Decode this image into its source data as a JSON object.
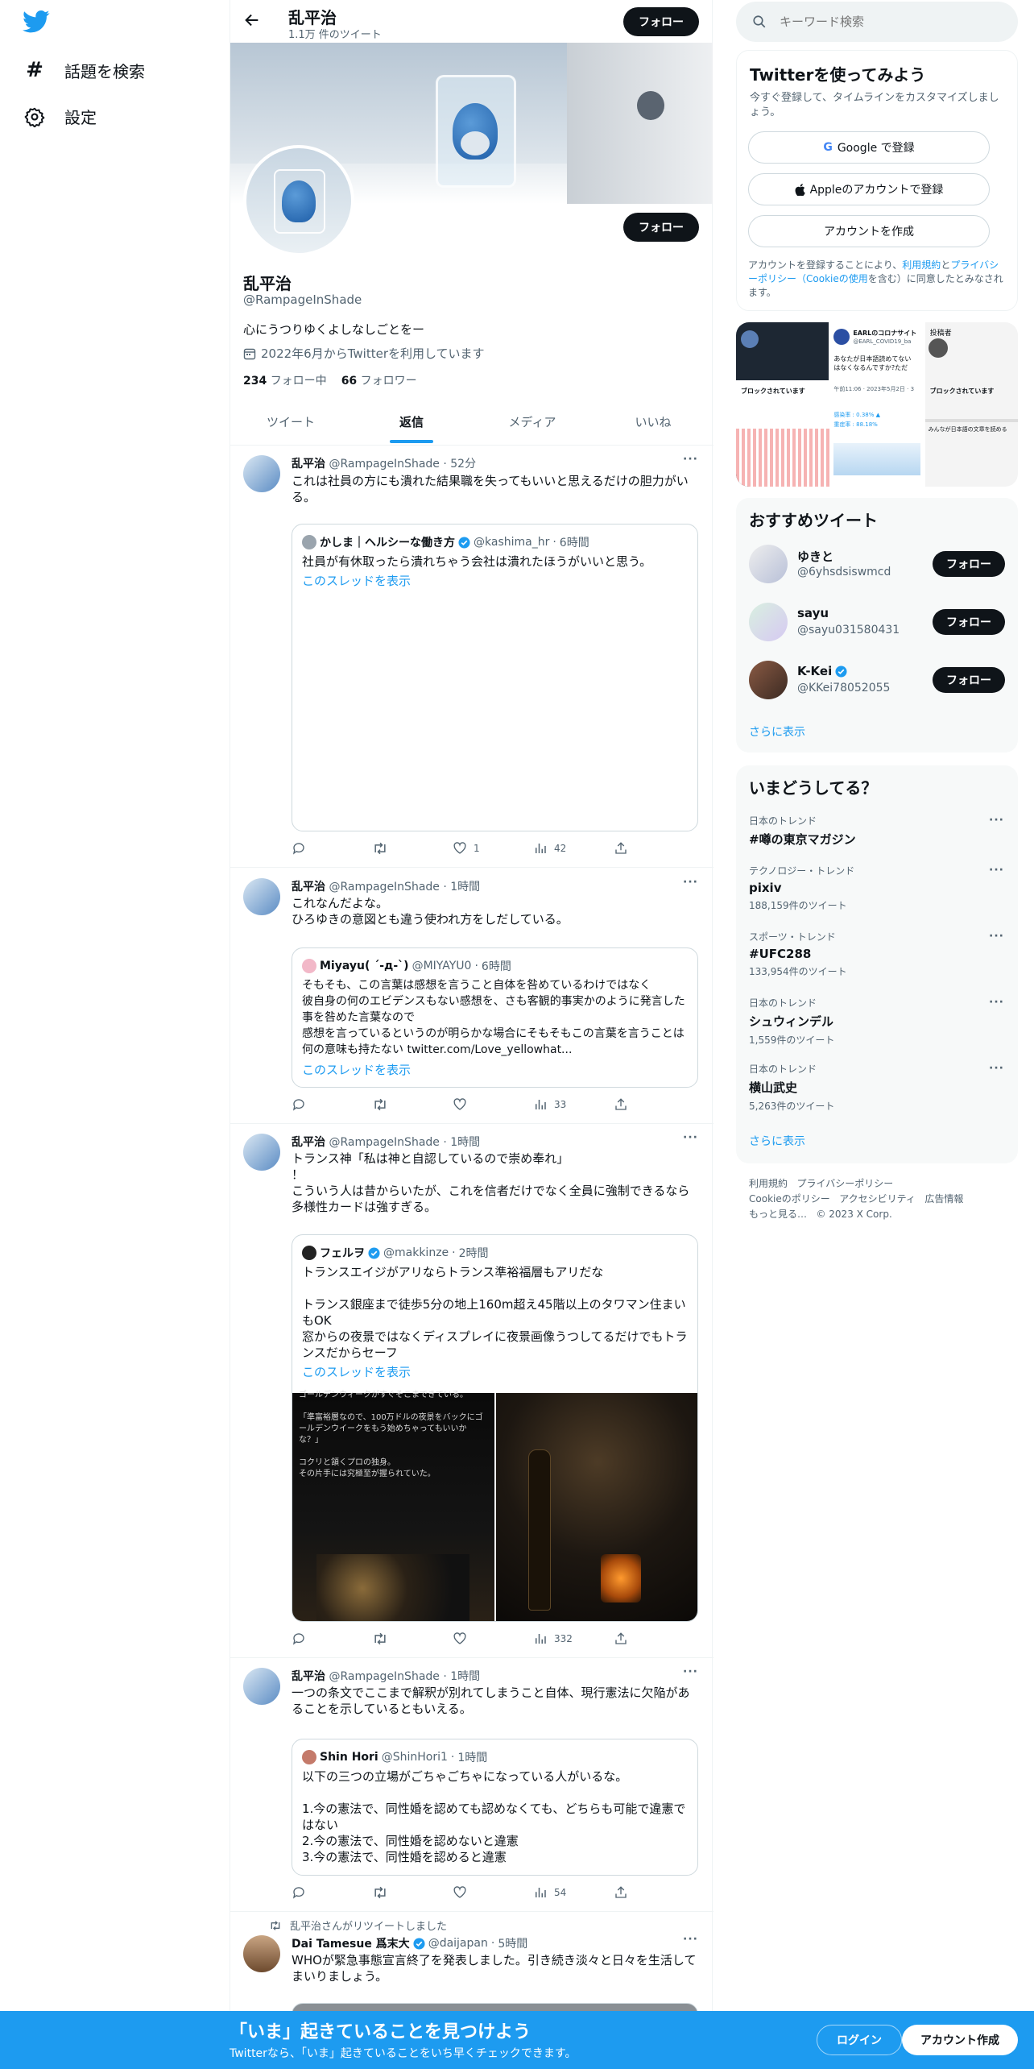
{
  "nav": {
    "explore": "話題を検索",
    "settings": "設定"
  },
  "header": {
    "name": "乱平治",
    "tweet_count": "1.1万 件のツイート",
    "follow": "フォロー"
  },
  "profile": {
    "name": "乱平治",
    "handle": "@RampageInShade",
    "bio": "心にうつりゆくよしなしごとをー",
    "joined": "2022年6月からTwitterを利用しています",
    "following_count": "234",
    "following_label": "フォロー中",
    "followers_count": "66",
    "followers_label": "フォロワー",
    "follow": "フォロー"
  },
  "tabs": [
    "ツイート",
    "返信",
    "メディア",
    "いいね"
  ],
  "tweets": [
    {
      "name": "乱平治",
      "handle": "@RampageInShade",
      "time": "52分",
      "text": "これは社員の方にも潰れた結果職を失ってもいいと思えるだけの胆力がいる。",
      "quote": {
        "name": "かしま｜ヘルシーな働き方",
        "handle": "@kashima_hr",
        "time": "6時間",
        "text": "社員が有休取ったら潰れちゃう会社は潰れたほうがいいと思う。",
        "thread": "このスレッドを表示"
      },
      "likes": "1",
      "views": "42"
    },
    {
      "name": "乱平治",
      "handle": "@RampageInShade",
      "time": "1時間",
      "text": "これなんだよな。\nひろゆきの意図とも違う使われ方をしだしている。",
      "quote": {
        "name": "Miyayu( ´-д-`)",
        "handle": "@MIYAYU0",
        "time": "6時間",
        "text": "そもそも、この言葉は感想を言うこと自体を咎めているわけではなく\n彼自身の何のエビデンスもない感想を、さも客観的事実かのように発言した事を咎めた言葉なので\n感想を言っているというのが明らかな場合にそもそもこの言葉を言うことは何の意味も持たない twitter.com/Love_yellowhat...",
        "thread": "このスレッドを表示"
      },
      "views": "33"
    },
    {
      "name": "乱平治",
      "handle": "@RampageInShade",
      "time": "1時間",
      "text": "トランス神「私は神と自認しているので崇め奉れ」\n！\nこういう人は昔からいたが、これを信者だけでなく全員に強制できるなら多様性カードは強すぎる。",
      "quote": {
        "name": "フェルヲ",
        "handle": "@makkinze",
        "time": "2時間",
        "text": "トランスエイジがアリならトランス準裕福層もアリだな\n\nトランス銀座まで徒歩5分の地上160m超え45階以上のタワマン住まいもOK\n窓からの夜景ではなくディスプレイに夜景画像うつしてるだけでもトランスだからセーフ",
        "thread": "このスレッドを表示",
        "img_text": "ゴールデンウィークがすぐそこまできている。\n\n「準富裕層なので、100万ドルの夜景をバックにゴールデンウイークをもう始めちゃってもいいかな？」\n\nコクリと頷くプロの独身。\nその片手には究極至が握られていた。"
      },
      "views": "332"
    },
    {
      "name": "乱平治",
      "handle": "@RampageInShade",
      "time": "1時間",
      "text": "一つの条文でここまで解釈が別れてしまうこと自体、現行憲法に欠陥があることを示しているともいえる。",
      "quote": {
        "name": "Shin Hori",
        "handle": "@ShinHori1",
        "time": "1時間",
        "text": "以下の三つの立場がごちゃごちゃになっている人がいるな。\n\n1.今の憲法で、同性婚を認めても認めなくても、どちらも可能で違憲ではない\n2.今の憲法で、同性婚を認めないと違憲\n3.今の憲法で、同性婚を認めると違憲"
      },
      "views": "54"
    },
    {
      "retweet_label": "乱平治さんがリツイートしました",
      "name": "Dai Tamesue 爲末大",
      "handle": "@daijapan",
      "time": "5時間",
      "text": "WHOが緊急事態宣言終了を発表しました。引き続き淡々と日々を生活してまいりましょう。"
    }
  ],
  "sidebar": {
    "search_placeholder": "キーワード検索",
    "signup": {
      "title": "Twitterを使ってみよう",
      "desc": "今すぐ登録して、タイムラインをカスタマイズしましょう。",
      "google": "Google で登録",
      "apple": "Appleのアカウントで登録",
      "create": "アカウントを作成",
      "legal_1": "アカウントを登録することにより、",
      "legal_terms": "利用規約",
      "legal_2": "と",
      "legal_privacy": "プライバシーポリシー（Cookieの使用",
      "legal_3": "を含む）に同意したとみなされます。"
    },
    "media_preview": {
      "c1": "ブロックされています",
      "c2_name": "EARLのコロナサイト",
      "c2_handle": "@EARL_COVID19_ba",
      "c2_text": "あなたが日本語読めてない\nはなくなるんですか?ただ",
      "c2_time": "午前11:06 · 2023年5月2日 · 3",
      "c2_stat1": "感染率 : 0.38% ▲",
      "c2_stat2": "重症率 : 88.18%",
      "c3_title": "投稿者",
      "c3_blocked": "ブロックされています",
      "c3_bottom": "みんなが日本語の文章を読める"
    },
    "recommend": {
      "title": "おすすめツイート",
      "users": [
        {
          "name": "ゆきと",
          "handle": "@6yhsdsiswmcd"
        },
        {
          "name": "sayu",
          "handle": "@sayu031580431"
        },
        {
          "name": "K-Kei",
          "handle": "@KKei78052055"
        }
      ],
      "follow": "フォロー",
      "more": "さらに表示"
    },
    "trends": {
      "title": "いまどうしてる？",
      "items": [
        {
          "context": "日本のトレンド",
          "name": "#噂の東京マガジン",
          "count": ""
        },
        {
          "context": "テクノロジー・トレンド",
          "name": "pixiv",
          "count": "188,159件のツイート"
        },
        {
          "context": "スポーツ・トレンド",
          "name": "#UFC288",
          "count": "133,954件のツイート"
        },
        {
          "context": "日本のトレンド",
          "name": "シュウィンデル",
          "count": "1,559件のツイート"
        },
        {
          "context": "日本のトレンド",
          "name": "横山武史",
          "count": "5,263件のツイート"
        }
      ],
      "more": "さらに表示"
    },
    "footer": {
      "terms": "利用規約",
      "privacy": "プライバシーポリシー",
      "cookie": "Cookieのポリシー",
      "accessibility": "アクセシビリティ",
      "ads": "広告情報",
      "more": "もっと見る…",
      "copyright": "© 2023 X Corp."
    }
  },
  "banner": {
    "title": "「いま」起きていることを見つけよう",
    "subtitle": "Twitterなら、「いま」起きていることをいち早くチェックできます。",
    "login": "ログイン",
    "signup": "アカウント作成"
  },
  "colors": {
    "accent": "#1d9bf0",
    "banner_bg": "#1d9bf0",
    "dark": "#0f1419"
  }
}
